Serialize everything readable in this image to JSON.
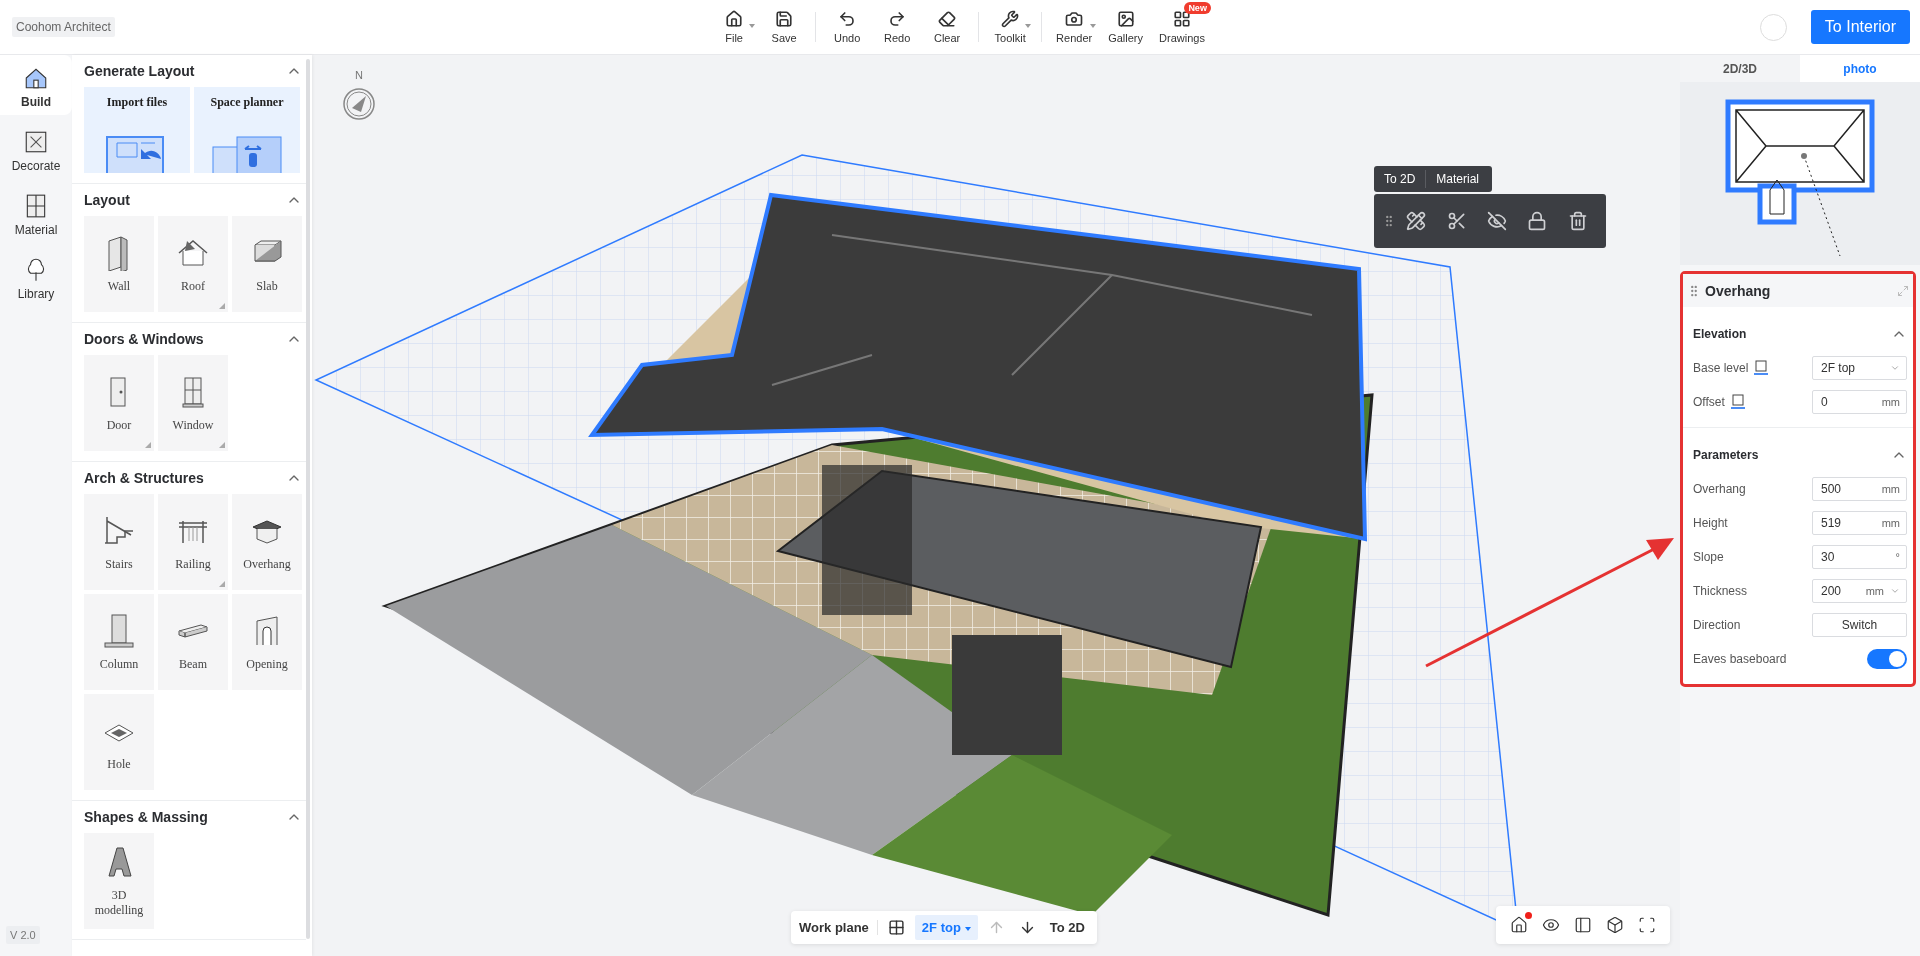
{
  "app": {
    "title": "Coohom Architect"
  },
  "toolbar": [
    [
      {
        "label": "File",
        "dropdown": true
      },
      {
        "label": "Save",
        "dropdown": false
      }
    ],
    [
      {
        "label": "Undo",
        "dropdown": false
      },
      {
        "label": "Redo",
        "dropdown": false
      },
      {
        "label": "Clear",
        "dropdown": false
      }
    ],
    [
      {
        "label": "Toolkit",
        "dropdown": true
      }
    ],
    [
      {
        "label": "Render",
        "dropdown": true
      },
      {
        "label": "Gallery",
        "dropdown": false
      },
      {
        "label": "Drawings",
        "dropdown": false,
        "badge": "New"
      }
    ]
  ],
  "primary_button": "To Interior",
  "rail": [
    {
      "label": "Build",
      "selected": true
    },
    {
      "label": "Decorate",
      "selected": false
    },
    {
      "label": "Material",
      "selected": false
    },
    {
      "label": "Library",
      "selected": false
    }
  ],
  "library": [
    {
      "title": "Generate Layout",
      "expanded": true,
      "kind": "features",
      "items": [
        {
          "label": "Import files"
        },
        {
          "label": "Space planner"
        }
      ]
    },
    {
      "title": "Layout",
      "expanded": true,
      "kind": "tiles",
      "items": [
        {
          "label": "Wall",
          "submenu": false
        },
        {
          "label": "Roof",
          "submenu": true
        },
        {
          "label": "Slab",
          "submenu": false
        }
      ]
    },
    {
      "title": "Doors & Windows",
      "expanded": true,
      "kind": "tiles",
      "items": [
        {
          "label": "Door",
          "submenu": true
        },
        {
          "label": "Window",
          "submenu": true
        }
      ]
    },
    {
      "title": "Arch & Structures",
      "expanded": true,
      "kind": "tiles",
      "items": [
        {
          "label": "Stairs",
          "submenu": false
        },
        {
          "label": "Railing",
          "submenu": true
        },
        {
          "label": "Overhang",
          "submenu": false
        },
        {
          "label": "Column",
          "submenu": false
        },
        {
          "label": "Beam",
          "submenu": false
        },
        {
          "label": "Opening",
          "submenu": false
        },
        {
          "label": "Hole",
          "submenu": false
        }
      ]
    },
    {
      "title": "Shapes & Massing",
      "expanded": true,
      "kind": "tiles",
      "items": [
        {
          "label": "3D modelling",
          "submenu": false
        }
      ]
    }
  ],
  "version": "V 2.0",
  "compass": "N",
  "context_menu": {
    "actions": [
      "To 2D",
      "Material"
    ]
  },
  "preview": {
    "tabs": [
      {
        "label": "2D/3D",
        "selected": false
      },
      {
        "label": "photo",
        "selected": true
      }
    ]
  },
  "properties": {
    "title": "Overhang",
    "sections": [
      {
        "title": "Elevation",
        "expanded": true,
        "fields": [
          {
            "kind": "select",
            "label": "Base level",
            "value": "2F top"
          },
          {
            "kind": "number",
            "label": "Offset",
            "value": "0",
            "unit": "mm"
          }
        ]
      },
      {
        "title": "Parameters",
        "expanded": true,
        "fields": [
          {
            "kind": "number",
            "label": "Overhang",
            "value": "500",
            "unit": "mm"
          },
          {
            "kind": "number",
            "label": "Height",
            "value": "519",
            "unit": "mm"
          },
          {
            "kind": "number",
            "label": "Slope",
            "value": "30",
            "unit": "°"
          },
          {
            "kind": "number_select",
            "label": "Thickness",
            "value": "200",
            "unit": "mm"
          },
          {
            "kind": "button",
            "label": "Direction",
            "value": "Switch"
          },
          {
            "kind": "toggle",
            "label": "Eaves baseboard",
            "on": true
          }
        ]
      }
    ]
  },
  "work_plane": {
    "label": "Work plane",
    "level": "2F top",
    "to2d": "To 2D"
  }
}
